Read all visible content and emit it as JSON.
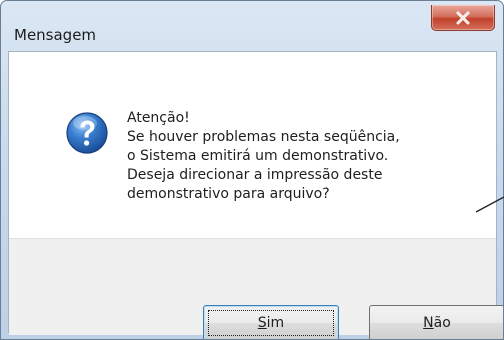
{
  "window": {
    "title": "Mensagem"
  },
  "title_bar": {
    "close_icon": "close-icon"
  },
  "message": {
    "icon": "question-icon",
    "lines": [
      "Atenção!",
      "Se houver problemas nesta seqüência,",
      "o Sistema emitirá um demonstrativo.",
      "Deseja direcionar a impressão deste",
      "demonstrativo para arquivo?"
    ]
  },
  "buttons": {
    "yes": {
      "mnemonic": "S",
      "rest": "im"
    },
    "no": {
      "mnemonic": "N",
      "rest": "ão"
    }
  },
  "colors": {
    "close_button": "#c0412c",
    "default_button_border": "#3c7fb1",
    "icon_blue": "#2a66b8"
  }
}
